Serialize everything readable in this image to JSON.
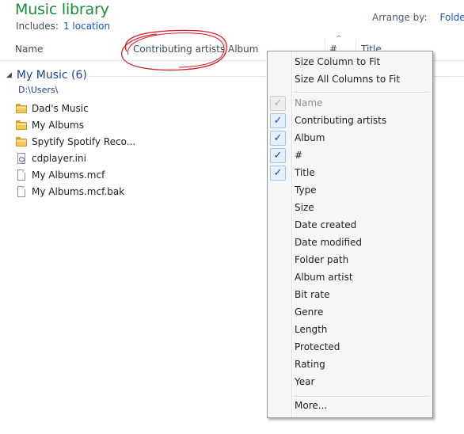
{
  "header": {
    "title": "Music library",
    "includes_label": "Includes:",
    "includes_link": "1 location",
    "arrange_label": "Arrange by:",
    "arrange_value": "Folder"
  },
  "columns": {
    "name": "Name",
    "contributing_artists": "Contributing artists",
    "album": "Album",
    "number": "#",
    "title": "Title"
  },
  "group": {
    "title": "My Music (6)",
    "path": "D:\\Users\\"
  },
  "files": [
    {
      "name": "Dad's Music",
      "icon": "folder-icon"
    },
    {
      "name": "My Albums",
      "icon": "folder-icon"
    },
    {
      "name": "Spytify Spotify Reco...",
      "icon": "folder-icon"
    },
    {
      "name": "cdplayer.ini",
      "icon": "settings-file-icon"
    },
    {
      "name": "My Albums.mcf",
      "icon": "document-icon"
    },
    {
      "name": "My Albums.mcf.bak",
      "icon": "document-icon"
    }
  ],
  "context_menu": {
    "size_column": "Size Column to Fit",
    "size_all": "Size All Columns to Fit",
    "items": [
      {
        "label": "Name",
        "checked": true,
        "disabled": true
      },
      {
        "label": "Contributing artists",
        "checked": true,
        "disabled": false
      },
      {
        "label": "Album",
        "checked": true,
        "disabled": false
      },
      {
        "label": "#",
        "checked": true,
        "disabled": false
      },
      {
        "label": "Title",
        "checked": true,
        "disabled": false
      },
      {
        "label": "Type",
        "checked": false,
        "disabled": false
      },
      {
        "label": "Size",
        "checked": false,
        "disabled": false
      },
      {
        "label": "Date created",
        "checked": false,
        "disabled": false
      },
      {
        "label": "Date modified",
        "checked": false,
        "disabled": false
      },
      {
        "label": "Folder path",
        "checked": false,
        "disabled": false
      },
      {
        "label": "Album artist",
        "checked": false,
        "disabled": false
      },
      {
        "label": "Bit rate",
        "checked": false,
        "disabled": false
      },
      {
        "label": "Genre",
        "checked": false,
        "disabled": false
      },
      {
        "label": "Length",
        "checked": false,
        "disabled": false
      },
      {
        "label": "Protected",
        "checked": false,
        "disabled": false
      },
      {
        "label": "Rating",
        "checked": false,
        "disabled": false
      },
      {
        "label": "Year",
        "checked": false,
        "disabled": false
      }
    ],
    "more": "More..."
  },
  "colors": {
    "title_green": "#1e8b3c",
    "link_blue": "#1a56c2",
    "annotation_red": "#d4202a"
  }
}
